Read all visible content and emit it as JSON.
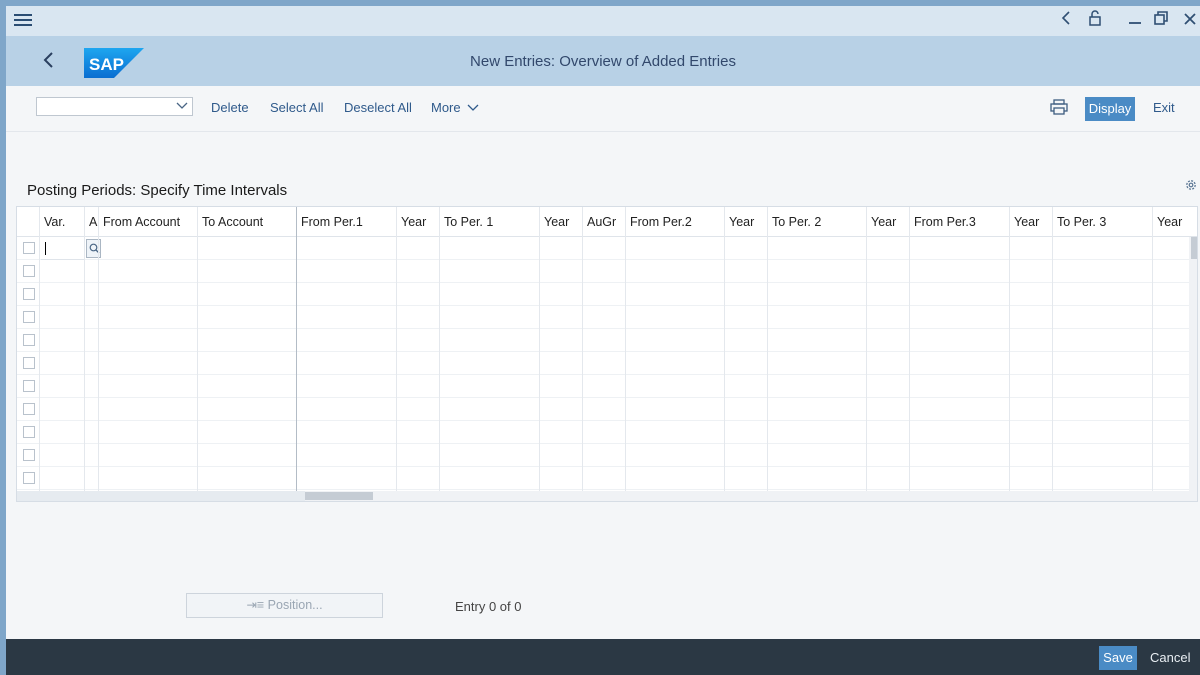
{
  "header": {
    "title": "New Entries: Overview of Added Entries",
    "logo_text": "SAP"
  },
  "toolbar": {
    "variant_value": "",
    "delete_label": "Delete",
    "select_all_label": "Select All",
    "deselect_all_label": "Deselect All",
    "more_label": "More",
    "display_label": "Display",
    "exit_label": "Exit"
  },
  "table": {
    "title": "Posting Periods: Specify Time Intervals",
    "columns": [
      "Var.",
      "A",
      "From Account",
      "To Account",
      "From Per.1",
      "Year",
      "To Per. 1",
      "Year",
      "AuGr",
      "From Per.2",
      "Year",
      "To Per. 2",
      "Year",
      "From Per.3",
      "Year",
      "To Per. 3",
      "Year"
    ],
    "row_count": 11
  },
  "bottom": {
    "position_label": "Position...",
    "entry_info": "Entry 0 of 0"
  },
  "footer": {
    "save_label": "Save",
    "cancel_label": "Cancel"
  },
  "colors": {
    "shell_header": "#b8d1e6",
    "titlebar": "#d9e6f1",
    "accent_button": "#4a8bc5",
    "footer": "#2b3844"
  }
}
